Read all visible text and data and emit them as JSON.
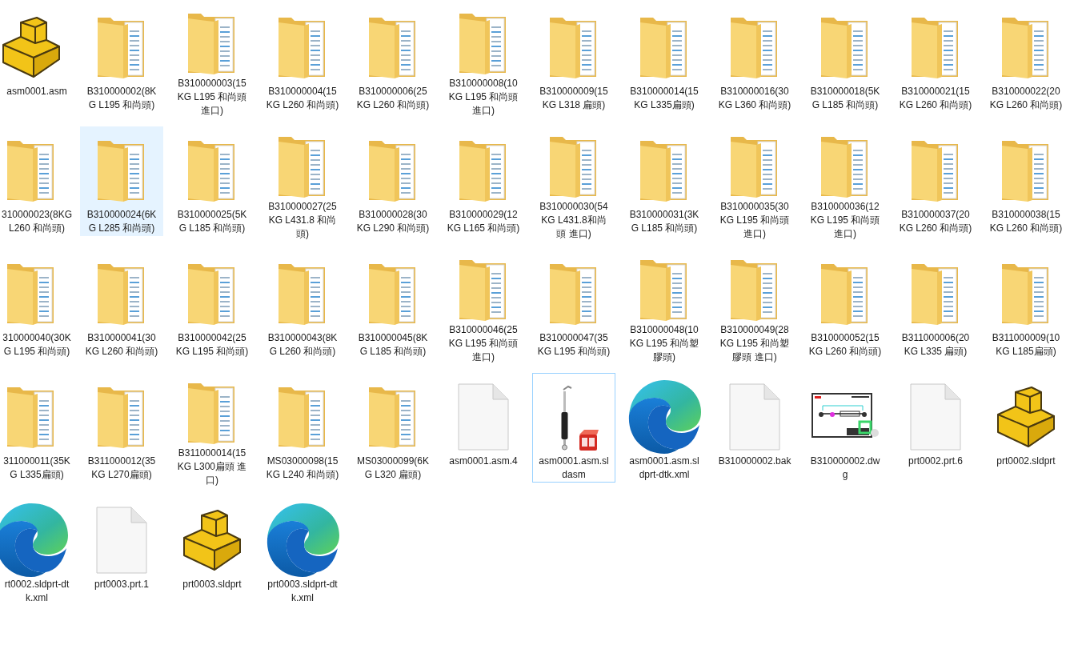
{
  "items": [
    {
      "kind": "part",
      "label": "asm0001.asm",
      "selected": false,
      "focused": false
    },
    {
      "kind": "folder",
      "label": "B310000002(8KG L195 和尚頭)",
      "selected": false,
      "focused": false
    },
    {
      "kind": "folder",
      "label": "B310000003(15KG L195 和尚頭進口)",
      "selected": false,
      "focused": false
    },
    {
      "kind": "folder",
      "label": "B310000004(15KG L260 和尚頭)",
      "selected": false,
      "focused": false
    },
    {
      "kind": "folder",
      "label": "B310000006(25KG L260 和尚頭)",
      "selected": false,
      "focused": false
    },
    {
      "kind": "folder",
      "label": "B310000008(10KG L195 和尚頭進口)",
      "selected": false,
      "focused": false
    },
    {
      "kind": "folder",
      "label": "B310000009(15KG L318 扁頭)",
      "selected": false,
      "focused": false
    },
    {
      "kind": "folder",
      "label": "B310000014(15KG L335扁頭)",
      "selected": false,
      "focused": false
    },
    {
      "kind": "folder",
      "label": "B310000016(30KG L360 和尚頭)",
      "selected": false,
      "focused": false
    },
    {
      "kind": "folder",
      "label": "B310000018(5KG L185 和尚頭)",
      "selected": false,
      "focused": false
    },
    {
      "kind": "folder",
      "label": "B310000021(15KG L260 和尚頭)",
      "selected": false,
      "focused": false
    },
    {
      "kind": "folder",
      "label": "B310000022(20KG L260 和尚頭)",
      "selected": false,
      "focused": false
    },
    {
      "kind": "folder",
      "label": "310000023(8KG L260 和尚頭)",
      "selected": false,
      "focused": false
    },
    {
      "kind": "folder",
      "label": "B310000024(6KG L285 和尚頭)",
      "selected": true,
      "focused": false
    },
    {
      "kind": "folder",
      "label": "B310000025(5KG L185 和尚頭)",
      "selected": false,
      "focused": false
    },
    {
      "kind": "folder",
      "label": "B310000027(25KG L431.8 和尚頭)",
      "selected": false,
      "focused": false
    },
    {
      "kind": "folder",
      "label": "B310000028(30KG L290 和尚頭)",
      "selected": false,
      "focused": false
    },
    {
      "kind": "folder",
      "label": "B310000029(12KG L165 和尚頭)",
      "selected": false,
      "focused": false
    },
    {
      "kind": "folder",
      "label": "B310000030(54KG L431.8和尚頭 進口)",
      "selected": false,
      "focused": false
    },
    {
      "kind": "folder",
      "label": "B310000031(3KG L185 和尚頭)",
      "selected": false,
      "focused": false
    },
    {
      "kind": "folder",
      "label": "B310000035(30KG L195 和尚頭進口)",
      "selected": false,
      "focused": false
    },
    {
      "kind": "folder",
      "label": "B310000036(12KG L195 和尚頭進口)",
      "selected": false,
      "focused": false
    },
    {
      "kind": "folder",
      "label": "B310000037(20KG L260 和尚頭)",
      "selected": false,
      "focused": false
    },
    {
      "kind": "folder",
      "label": "B310000038(15KG L260 和尚頭)",
      "selected": false,
      "focused": false
    },
    {
      "kind": "folder",
      "label": "310000040(30KG L195 和尚頭)",
      "selected": false,
      "focused": false
    },
    {
      "kind": "folder",
      "label": "B310000041(30KG L260 和尚頭)",
      "selected": false,
      "focused": false
    },
    {
      "kind": "folder",
      "label": "B310000042(25KG L195 和尚頭)",
      "selected": false,
      "focused": false
    },
    {
      "kind": "folder",
      "label": "B310000043(8KG L260 和尚頭)",
      "selected": false,
      "focused": false
    },
    {
      "kind": "folder",
      "label": "B310000045(8KG L185 和尚頭)",
      "selected": false,
      "focused": false
    },
    {
      "kind": "folder",
      "label": "B310000046(25KG L195 和尚頭進口)",
      "selected": false,
      "focused": false
    },
    {
      "kind": "folder",
      "label": "B310000047(35KG L195 和尚頭)",
      "selected": false,
      "focused": false
    },
    {
      "kind": "folder",
      "label": "B310000048(10KG L195 和尚塑膠頭)",
      "selected": false,
      "focused": false
    },
    {
      "kind": "folder",
      "label": "B310000049(28KG L195 和尚塑膠頭 進口)",
      "selected": false,
      "focused": false
    },
    {
      "kind": "folder",
      "label": "B310000052(15KG L260 和尚頭)",
      "selected": false,
      "focused": false
    },
    {
      "kind": "folder",
      "label": "B311000006(20KG L335 扁頭)",
      "selected": false,
      "focused": false
    },
    {
      "kind": "folder",
      "label": "B311000009(10KG L185扁頭)",
      "selected": false,
      "focused": false
    },
    {
      "kind": "folder",
      "label": "311000011(35KG L335扁頭)",
      "selected": false,
      "focused": false
    },
    {
      "kind": "folder",
      "label": "B311000012(35KG L270扁頭)",
      "selected": false,
      "focused": false
    },
    {
      "kind": "folder",
      "label": "B311000014(15KG L300扁頭 進口)",
      "selected": false,
      "focused": false
    },
    {
      "kind": "folder",
      "label": "MS03000098(15KG L240 和尚頭)",
      "selected": false,
      "focused": false
    },
    {
      "kind": "folder",
      "label": "MS03000099(6KG L320 扁頭)",
      "selected": false,
      "focused": false
    },
    {
      "kind": "file",
      "label": "asm0001.asm.4",
      "selected": false,
      "focused": false
    },
    {
      "kind": "assembly",
      "label": "asm0001.asm.sldasm",
      "selected": false,
      "focused": true
    },
    {
      "kind": "swirl",
      "label": "asm0001.asm.sldprt-dtk.xml",
      "selected": false,
      "focused": false
    },
    {
      "kind": "file",
      "label": "B310000002.bak",
      "selected": false,
      "focused": false
    },
    {
      "kind": "drawing",
      "label": "B310000002.dwg",
      "selected": false,
      "focused": false
    },
    {
      "kind": "file",
      "label": "prt0002.prt.6",
      "selected": false,
      "focused": false
    },
    {
      "kind": "part",
      "label": "prt0002.sldprt",
      "selected": false,
      "focused": false
    },
    {
      "kind": "swirl",
      "label": "rt0002.sldprt-dtk.xml",
      "selected": false,
      "focused": false
    },
    {
      "kind": "file",
      "label": "prt0003.prt.1",
      "selected": false,
      "focused": false
    },
    {
      "kind": "part",
      "label": "prt0003.sldprt",
      "selected": false,
      "focused": false
    },
    {
      "kind": "swirl",
      "label": "prt0003.sldprt-dtk.xml",
      "selected": false,
      "focused": false
    }
  ]
}
